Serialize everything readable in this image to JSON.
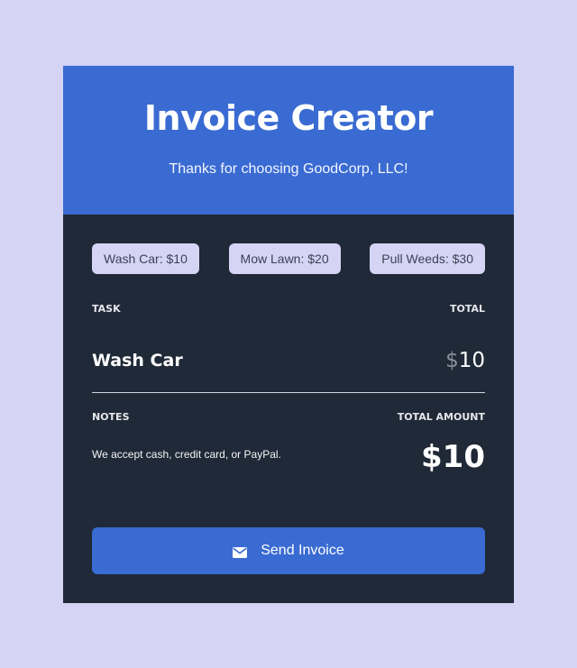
{
  "header": {
    "title": "Invoice Creator",
    "subtitle": "Thanks for choosing GoodCorp, LLC!"
  },
  "services": [
    {
      "label": "Wash Car: $10"
    },
    {
      "label": "Mow Lawn: $20"
    },
    {
      "label": "Pull Weeds: $30"
    }
  ],
  "table": {
    "task_header": "TASK",
    "total_header": "TOTAL",
    "items": [
      {
        "name": "Wash Car",
        "currency": "$",
        "total": "10"
      }
    ]
  },
  "summary": {
    "notes_label": "NOTES",
    "total_amount_label": "TOTAL AMOUNT",
    "notes_text": "We accept cash, credit card, or PayPal.",
    "total_amount": "$10"
  },
  "actions": {
    "send_label": "Send Invoice",
    "send_icon": "envelope-icon"
  },
  "colors": {
    "page_background": "#d5d4f5",
    "accent": "#3a6bd3",
    "card_background": "#1f2937"
  }
}
